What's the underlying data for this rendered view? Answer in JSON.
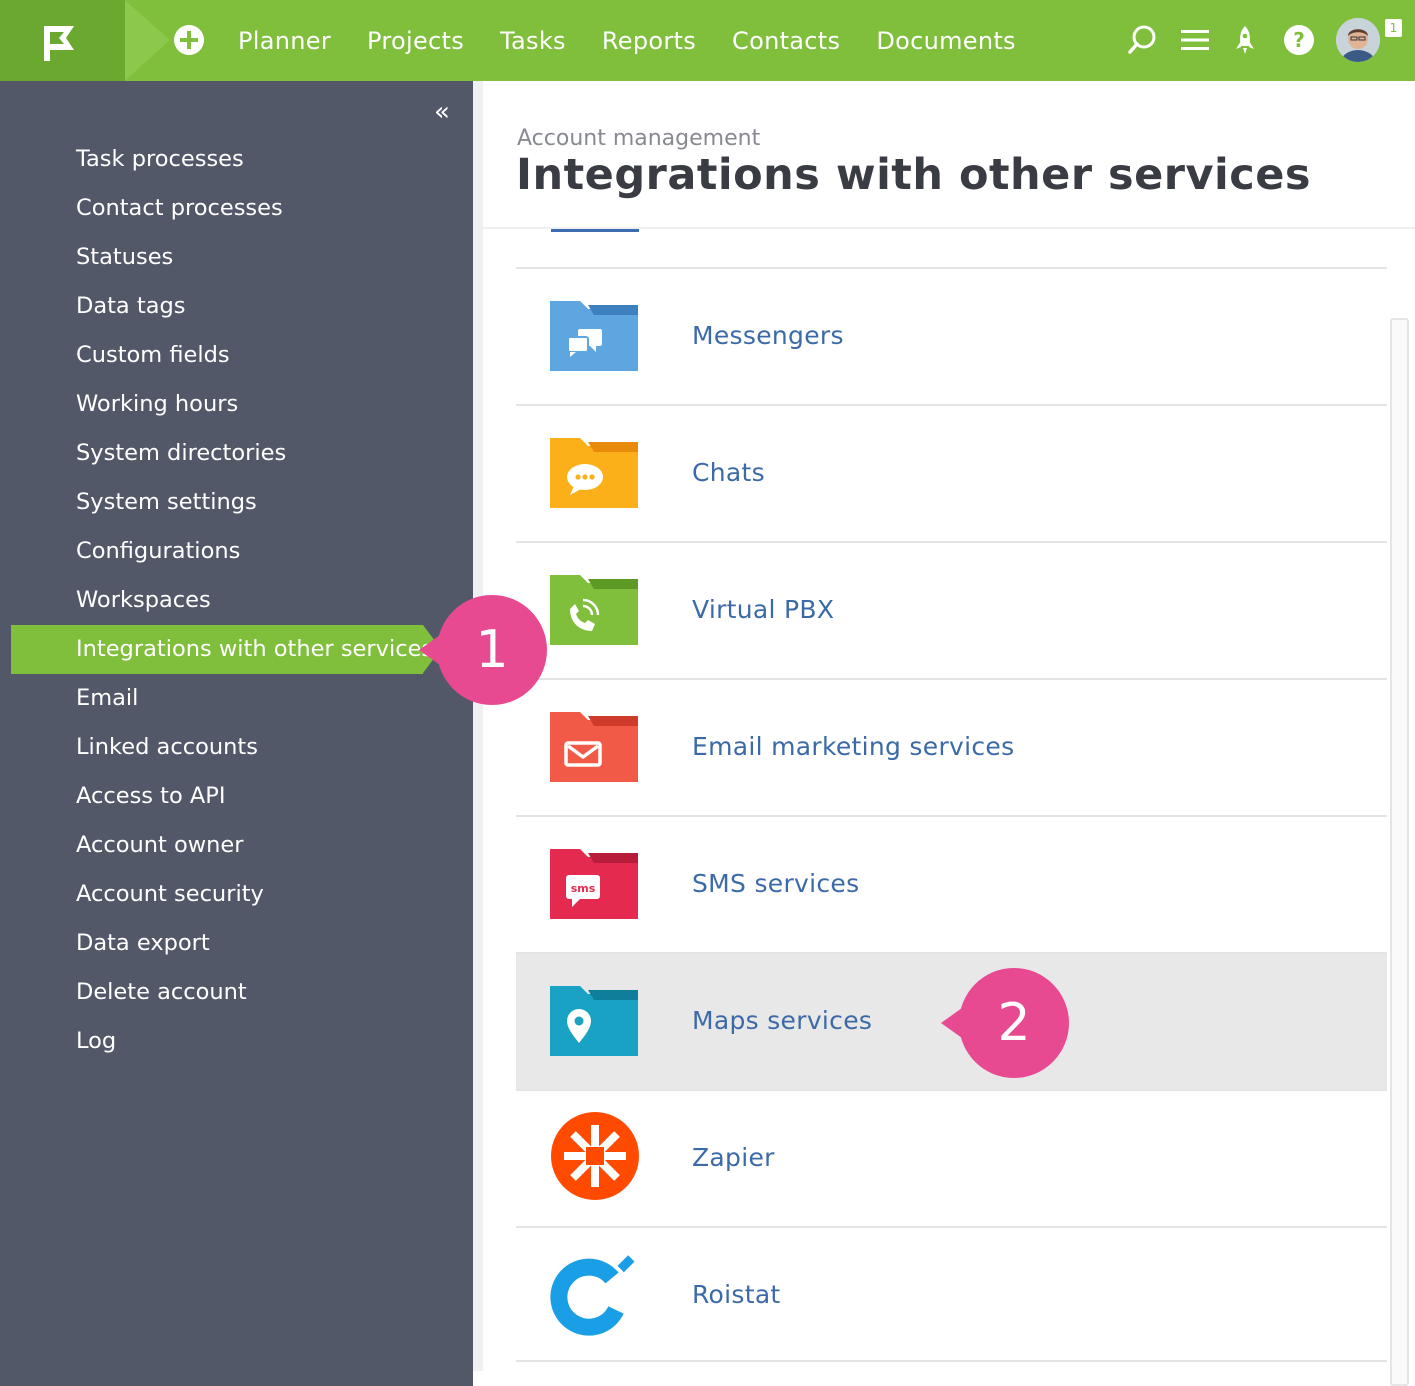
{
  "topbar": {
    "nav": [
      "Planner",
      "Projects",
      "Tasks",
      "Reports",
      "Contacts",
      "Documents"
    ],
    "notifications_count": "1",
    "colors": {
      "bar": "#7fbf3c",
      "logo_block": "#6aa82f"
    },
    "icons": [
      "add-icon",
      "search-icon",
      "menu-icon",
      "rocket-icon",
      "help-icon"
    ]
  },
  "sidebar": {
    "collapse_glyph": "«",
    "items": [
      {
        "label": "Task processes",
        "active": false
      },
      {
        "label": "Contact processes",
        "active": false
      },
      {
        "label": "Statuses",
        "active": false
      },
      {
        "label": "Data tags",
        "active": false
      },
      {
        "label": "Custom fields",
        "active": false
      },
      {
        "label": "Working hours",
        "active": false
      },
      {
        "label": "System directories",
        "active": false
      },
      {
        "label": "System settings",
        "active": false
      },
      {
        "label": "Configurations",
        "active": false
      },
      {
        "label": "Workspaces",
        "active": false
      },
      {
        "label": "Integrations with other services",
        "active": true
      },
      {
        "label": "Email",
        "active": false
      },
      {
        "label": "Linked accounts",
        "active": false
      },
      {
        "label": "Access to API",
        "active": false
      },
      {
        "label": "Account owner",
        "active": false
      },
      {
        "label": "Account security",
        "active": false
      },
      {
        "label": "Data export",
        "active": false
      },
      {
        "label": "Delete account",
        "active": false
      },
      {
        "label": "Log",
        "active": false
      }
    ]
  },
  "main": {
    "breadcrumb": "Account management",
    "title": "Integrations with other services",
    "services": [
      {
        "label": "Messengers",
        "icon": "messengers-folder-icon",
        "color": "#5ea6e0"
      },
      {
        "label": "Chats",
        "icon": "chats-folder-icon",
        "color": "#fbb01a"
      },
      {
        "label": "Virtual PBX",
        "icon": "virtual-pbx-folder-icon",
        "color": "#7fbf3c"
      },
      {
        "label": "Email marketing services",
        "icon": "email-marketing-folder-icon",
        "color": "#f15a47"
      },
      {
        "label": "SMS services",
        "icon": "sms-folder-icon",
        "color": "#e42a4f",
        "icon_text": "sms"
      },
      {
        "label": "Maps services",
        "icon": "maps-folder-icon",
        "color": "#1aa2c5",
        "highlighted": true
      },
      {
        "label": "Zapier",
        "icon": "zapier-logo-icon",
        "color": "#ff4a00"
      },
      {
        "label": "Roistat",
        "icon": "roistat-logo-icon",
        "color": "#1a9ee6"
      }
    ]
  },
  "callouts": [
    {
      "number": "1",
      "color": "#e84a92"
    },
    {
      "number": "2",
      "color": "#e84a92"
    }
  ]
}
